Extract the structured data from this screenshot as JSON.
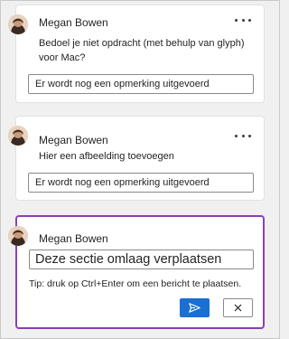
{
  "icons": {
    "more": "more-options-icon",
    "send": "send-icon",
    "cancel": "close-icon",
    "avatar": "avatar-photo"
  },
  "colors": {
    "active_border": "#8a3fb5",
    "send_button": "#1a6fd1"
  },
  "threads": [
    {
      "author": "Megan Bowen",
      "text": "Bedoel je niet opdracht (met behulp van glyph) voor Mac?",
      "reply": "Er wordt nog een opmerking uitgevoerd"
    },
    {
      "author": "Megan Bowen",
      "text": "Hier een afbeelding toevoegen",
      "reply": "Er wordt nog een opmerking uitgevoerd"
    }
  ],
  "new_comment": {
    "author": "Megan Bowen",
    "input_value": "Deze sectie omlaag verplaatsen",
    "tip": "Tip: druk op Ctrl+Enter om een bericht te plaatsen."
  }
}
